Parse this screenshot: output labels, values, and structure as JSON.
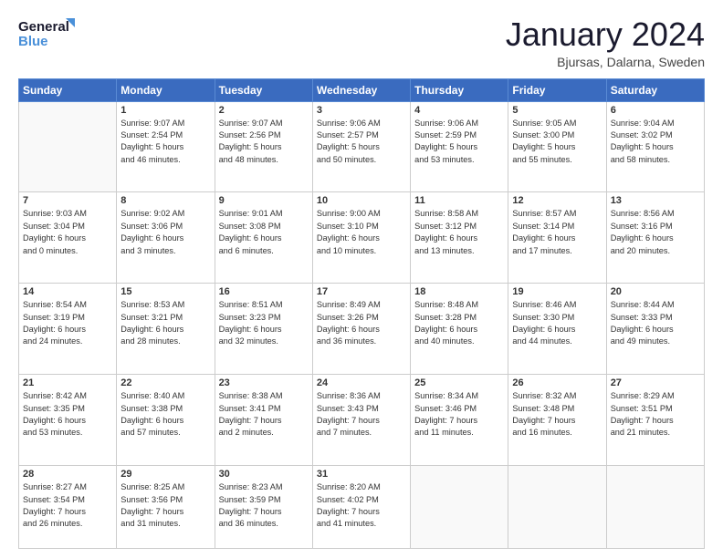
{
  "header": {
    "logo_line1": "General",
    "logo_line2": "Blue",
    "title": "January 2024",
    "location": "Bjursas, Dalarna, Sweden"
  },
  "weekdays": [
    "Sunday",
    "Monday",
    "Tuesday",
    "Wednesday",
    "Thursday",
    "Friday",
    "Saturday"
  ],
  "weeks": [
    [
      {
        "day": "",
        "info": ""
      },
      {
        "day": "1",
        "info": "Sunrise: 9:07 AM\nSunset: 2:54 PM\nDaylight: 5 hours\nand 46 minutes."
      },
      {
        "day": "2",
        "info": "Sunrise: 9:07 AM\nSunset: 2:56 PM\nDaylight: 5 hours\nand 48 minutes."
      },
      {
        "day": "3",
        "info": "Sunrise: 9:06 AM\nSunset: 2:57 PM\nDaylight: 5 hours\nand 50 minutes."
      },
      {
        "day": "4",
        "info": "Sunrise: 9:06 AM\nSunset: 2:59 PM\nDaylight: 5 hours\nand 53 minutes."
      },
      {
        "day": "5",
        "info": "Sunrise: 9:05 AM\nSunset: 3:00 PM\nDaylight: 5 hours\nand 55 minutes."
      },
      {
        "day": "6",
        "info": "Sunrise: 9:04 AM\nSunset: 3:02 PM\nDaylight: 5 hours\nand 58 minutes."
      }
    ],
    [
      {
        "day": "7",
        "info": "Sunrise: 9:03 AM\nSunset: 3:04 PM\nDaylight: 6 hours\nand 0 minutes."
      },
      {
        "day": "8",
        "info": "Sunrise: 9:02 AM\nSunset: 3:06 PM\nDaylight: 6 hours\nand 3 minutes."
      },
      {
        "day": "9",
        "info": "Sunrise: 9:01 AM\nSunset: 3:08 PM\nDaylight: 6 hours\nand 6 minutes."
      },
      {
        "day": "10",
        "info": "Sunrise: 9:00 AM\nSunset: 3:10 PM\nDaylight: 6 hours\nand 10 minutes."
      },
      {
        "day": "11",
        "info": "Sunrise: 8:58 AM\nSunset: 3:12 PM\nDaylight: 6 hours\nand 13 minutes."
      },
      {
        "day": "12",
        "info": "Sunrise: 8:57 AM\nSunset: 3:14 PM\nDaylight: 6 hours\nand 17 minutes."
      },
      {
        "day": "13",
        "info": "Sunrise: 8:56 AM\nSunset: 3:16 PM\nDaylight: 6 hours\nand 20 minutes."
      }
    ],
    [
      {
        "day": "14",
        "info": "Sunrise: 8:54 AM\nSunset: 3:19 PM\nDaylight: 6 hours\nand 24 minutes."
      },
      {
        "day": "15",
        "info": "Sunrise: 8:53 AM\nSunset: 3:21 PM\nDaylight: 6 hours\nand 28 minutes."
      },
      {
        "day": "16",
        "info": "Sunrise: 8:51 AM\nSunset: 3:23 PM\nDaylight: 6 hours\nand 32 minutes."
      },
      {
        "day": "17",
        "info": "Sunrise: 8:49 AM\nSunset: 3:26 PM\nDaylight: 6 hours\nand 36 minutes."
      },
      {
        "day": "18",
        "info": "Sunrise: 8:48 AM\nSunset: 3:28 PM\nDaylight: 6 hours\nand 40 minutes."
      },
      {
        "day": "19",
        "info": "Sunrise: 8:46 AM\nSunset: 3:30 PM\nDaylight: 6 hours\nand 44 minutes."
      },
      {
        "day": "20",
        "info": "Sunrise: 8:44 AM\nSunset: 3:33 PM\nDaylight: 6 hours\nand 49 minutes."
      }
    ],
    [
      {
        "day": "21",
        "info": "Sunrise: 8:42 AM\nSunset: 3:35 PM\nDaylight: 6 hours\nand 53 minutes."
      },
      {
        "day": "22",
        "info": "Sunrise: 8:40 AM\nSunset: 3:38 PM\nDaylight: 6 hours\nand 57 minutes."
      },
      {
        "day": "23",
        "info": "Sunrise: 8:38 AM\nSunset: 3:41 PM\nDaylight: 7 hours\nand 2 minutes."
      },
      {
        "day": "24",
        "info": "Sunrise: 8:36 AM\nSunset: 3:43 PM\nDaylight: 7 hours\nand 7 minutes."
      },
      {
        "day": "25",
        "info": "Sunrise: 8:34 AM\nSunset: 3:46 PM\nDaylight: 7 hours\nand 11 minutes."
      },
      {
        "day": "26",
        "info": "Sunrise: 8:32 AM\nSunset: 3:48 PM\nDaylight: 7 hours\nand 16 minutes."
      },
      {
        "day": "27",
        "info": "Sunrise: 8:29 AM\nSunset: 3:51 PM\nDaylight: 7 hours\nand 21 minutes."
      }
    ],
    [
      {
        "day": "28",
        "info": "Sunrise: 8:27 AM\nSunset: 3:54 PM\nDaylight: 7 hours\nand 26 minutes."
      },
      {
        "day": "29",
        "info": "Sunrise: 8:25 AM\nSunset: 3:56 PM\nDaylight: 7 hours\nand 31 minutes."
      },
      {
        "day": "30",
        "info": "Sunrise: 8:23 AM\nSunset: 3:59 PM\nDaylight: 7 hours\nand 36 minutes."
      },
      {
        "day": "31",
        "info": "Sunrise: 8:20 AM\nSunset: 4:02 PM\nDaylight: 7 hours\nand 41 minutes."
      },
      {
        "day": "",
        "info": ""
      },
      {
        "day": "",
        "info": ""
      },
      {
        "day": "",
        "info": ""
      }
    ]
  ]
}
